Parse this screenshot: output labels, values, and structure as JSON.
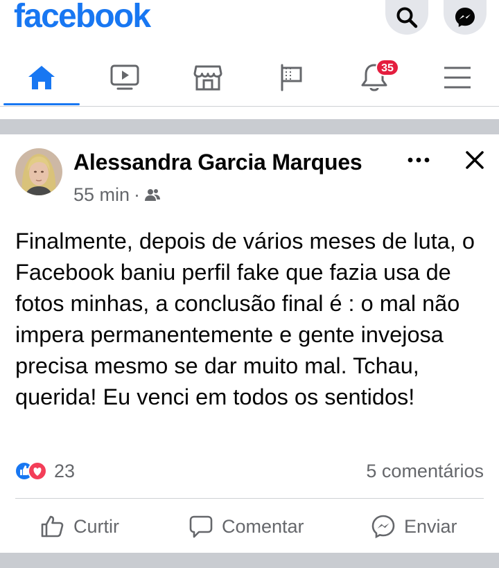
{
  "app": {
    "logo_text": "facebook",
    "brand_color": "#1877f2"
  },
  "topbar": {
    "search_icon": "search-icon",
    "messenger_icon": "messenger-icon"
  },
  "tabs": [
    {
      "name": "home",
      "icon": "home-icon",
      "active": true
    },
    {
      "name": "watch",
      "icon": "video-icon",
      "active": false
    },
    {
      "name": "marketplace",
      "icon": "store-icon",
      "active": false
    },
    {
      "name": "pages",
      "icon": "flag-icon",
      "active": false
    },
    {
      "name": "notifications",
      "icon": "bell-icon",
      "active": false,
      "badge": "35"
    },
    {
      "name": "menu",
      "icon": "hamburger-icon",
      "active": false
    }
  ],
  "post": {
    "author": "Alessandra Garcia Marques",
    "time": "55 min",
    "separator": "·",
    "audience_icon": "friends-icon",
    "text": "Finalmente, depois de vários meses de luta, o Facebook baniu perfil fake que fazia usa de fotos minhas, a conclusão final é : o mal não impera permanentemente e gente invejosa precisa mesmo se dar muito mal. Tchau, querida! Eu venci em todos os sentidos!",
    "reactions": {
      "types": [
        "like",
        "love"
      ],
      "count": "23"
    },
    "comments": "5 comentários",
    "actions": {
      "like": "Curtir",
      "comment": "Comentar",
      "share": "Enviar"
    }
  }
}
